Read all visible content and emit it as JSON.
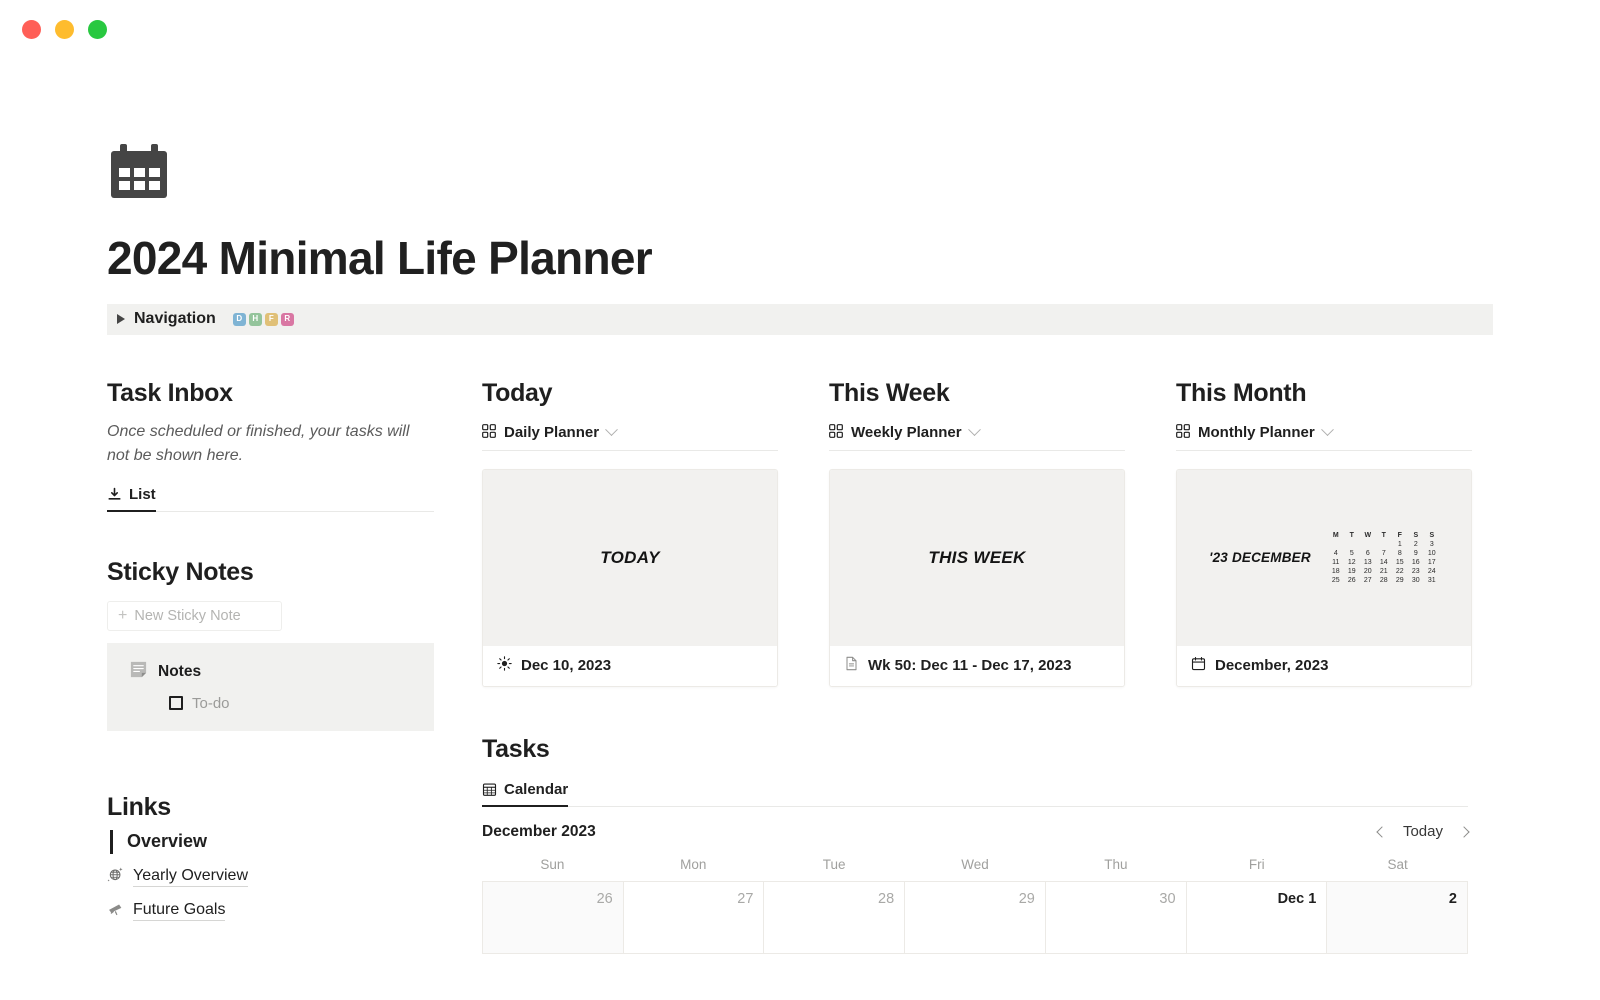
{
  "window": {
    "controls": [
      "close",
      "minimize",
      "maximize"
    ]
  },
  "header": {
    "icon": "calendar-icon",
    "title": "2024 Minimal Life Planner"
  },
  "navigation": {
    "label": "Navigation",
    "caret": "triangle-right-icon",
    "badges": [
      {
        "letter": "D",
        "color": "#7fb4d4"
      },
      {
        "letter": "H",
        "color": "#94c49b"
      },
      {
        "letter": "F",
        "color": "#e0c077"
      },
      {
        "letter": "R",
        "color": "#d977a3"
      }
    ]
  },
  "task_inbox": {
    "title": "Task Inbox",
    "description": "Once scheduled or finished, your tasks will not be shown here.",
    "tab": {
      "label": "List",
      "icon": "download-list-icon"
    }
  },
  "sticky_notes": {
    "title": "Sticky Notes",
    "new_button": {
      "label": "New Sticky Note",
      "icon": "plus-icon"
    },
    "card": {
      "icon": "note-icon",
      "title": "Notes",
      "todo_label": "To-do"
    }
  },
  "links": {
    "title": "Links",
    "overview_label": "Overview",
    "items": [
      {
        "label": "Yearly Overview",
        "icon": "globe-sparkle-icon"
      },
      {
        "label": "Future Goals",
        "icon": "telescope-icon"
      }
    ]
  },
  "planners": [
    {
      "title": "Today",
      "source": "Daily Planner",
      "source_icon": "grid-icon",
      "chevron": "chevron-down-icon",
      "card_label": "TODAY",
      "foot_icon": "sun-icon",
      "foot_label": "Dec 10, 2023",
      "mini_calendar": null
    },
    {
      "title": "This Week",
      "source": "Weekly Planner",
      "source_icon": "grid-icon",
      "chevron": "chevron-down-icon",
      "card_label": "THIS WEEK",
      "foot_icon": "document-icon",
      "foot_label": "Wk 50: Dec 11 - Dec 17, 2023",
      "mini_calendar": null
    },
    {
      "title": "This Month",
      "source": "Monthly Planner",
      "source_icon": "grid-icon",
      "chevron": "chevron-down-icon",
      "card_label": "'23 DECEMBER",
      "foot_icon": "calendar-small-icon",
      "foot_label": "December, 2023",
      "mini_calendar": {
        "weekday_headers": [
          "M",
          "T",
          "W",
          "T",
          "F",
          "S",
          "S"
        ],
        "days": [
          "",
          "",
          "",
          "",
          "1",
          "2",
          "3",
          "4",
          "5",
          "6",
          "7",
          "8",
          "9",
          "10",
          "11",
          "12",
          "13",
          "14",
          "15",
          "16",
          "17",
          "18",
          "19",
          "20",
          "21",
          "22",
          "23",
          "24",
          "25",
          "26",
          "27",
          "28",
          "29",
          "30",
          "31"
        ]
      }
    }
  ],
  "tasks": {
    "title": "Tasks",
    "tab": {
      "label": "Calendar",
      "icon": "calendar-view-icon"
    },
    "calendar": {
      "month_label": "December 2023",
      "prev_icon": "chevron-left-icon",
      "next_icon": "chevron-right-icon",
      "today_label": "Today",
      "day_headers": [
        "Sun",
        "Mon",
        "Tue",
        "Wed",
        "Thu",
        "Fri",
        "Sat"
      ],
      "cells": [
        {
          "label": "26",
          "muted": true,
          "weekend": true
        },
        {
          "label": "27",
          "muted": true,
          "weekend": false
        },
        {
          "label": "28",
          "muted": true,
          "weekend": false
        },
        {
          "label": "29",
          "muted": true,
          "weekend": false
        },
        {
          "label": "30",
          "muted": true,
          "weekend": false
        },
        {
          "label": "Dec 1",
          "muted": false,
          "weekend": false
        },
        {
          "label": "2",
          "muted": false,
          "weekend": true
        }
      ]
    }
  }
}
